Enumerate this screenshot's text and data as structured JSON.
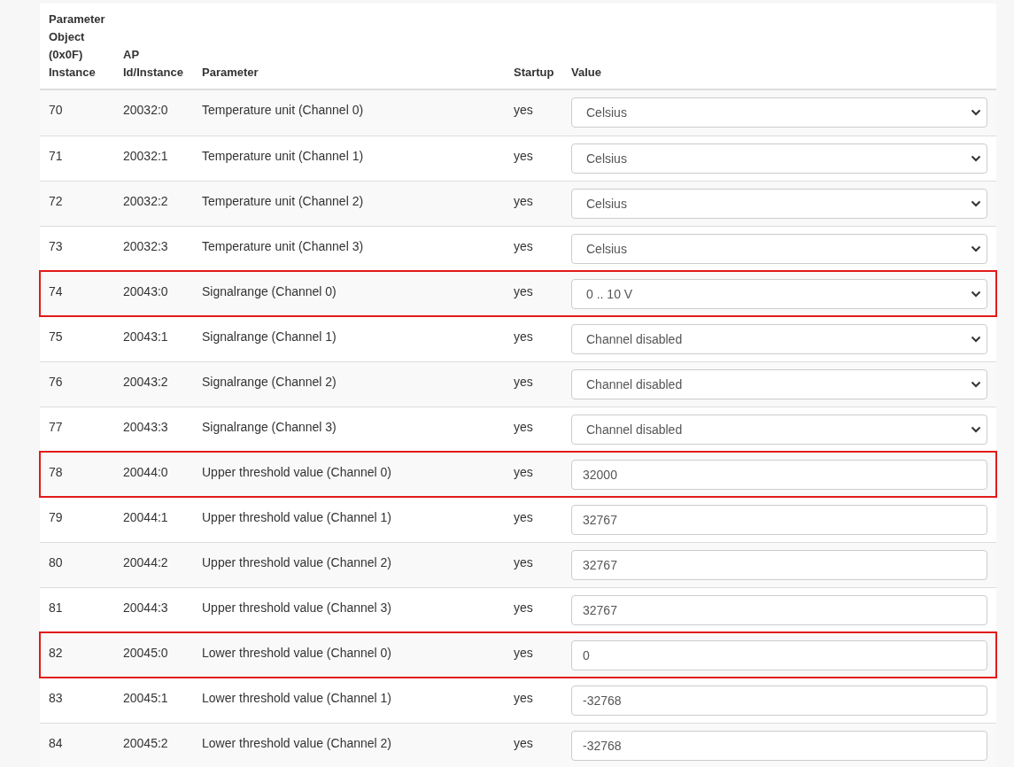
{
  "table": {
    "columns": [
      "Parameter Object (0x0F) Instance",
      "AP Id/Instance",
      "Parameter",
      "Startup",
      "Value"
    ],
    "rows": [
      {
        "instance": "70",
        "ap": "20032:0",
        "parameter": "Temperature unit (Channel 0)",
        "startup": "yes",
        "kind": "select",
        "value": "Celsius",
        "highlighted": false
      },
      {
        "instance": "71",
        "ap": "20032:1",
        "parameter": "Temperature unit (Channel 1)",
        "startup": "yes",
        "kind": "select",
        "value": "Celsius",
        "highlighted": false
      },
      {
        "instance": "72",
        "ap": "20032:2",
        "parameter": "Temperature unit (Channel 2)",
        "startup": "yes",
        "kind": "select",
        "value": "Celsius",
        "highlighted": false
      },
      {
        "instance": "73",
        "ap": "20032:3",
        "parameter": "Temperature unit (Channel 3)",
        "startup": "yes",
        "kind": "select",
        "value": "Celsius",
        "highlighted": false
      },
      {
        "instance": "74",
        "ap": "20043:0",
        "parameter": "Signalrange (Channel 0)",
        "startup": "yes",
        "kind": "select",
        "value": "0 .. 10 V",
        "highlighted": true
      },
      {
        "instance": "75",
        "ap": "20043:1",
        "parameter": "Signalrange (Channel 1)",
        "startup": "yes",
        "kind": "select",
        "value": "Channel disabled",
        "highlighted": false
      },
      {
        "instance": "76",
        "ap": "20043:2",
        "parameter": "Signalrange (Channel 2)",
        "startup": "yes",
        "kind": "select",
        "value": "Channel disabled",
        "highlighted": false
      },
      {
        "instance": "77",
        "ap": "20043:3",
        "parameter": "Signalrange (Channel 3)",
        "startup": "yes",
        "kind": "select",
        "value": "Channel disabled",
        "highlighted": false
      },
      {
        "instance": "78",
        "ap": "20044:0",
        "parameter": "Upper threshold value (Channel 0)",
        "startup": "yes",
        "kind": "input",
        "value": "32000",
        "highlighted": true
      },
      {
        "instance": "79",
        "ap": "20044:1",
        "parameter": "Upper threshold value (Channel 1)",
        "startup": "yes",
        "kind": "input",
        "value": "32767",
        "highlighted": false
      },
      {
        "instance": "80",
        "ap": "20044:2",
        "parameter": "Upper threshold value (Channel 2)",
        "startup": "yes",
        "kind": "input",
        "value": "32767",
        "highlighted": false
      },
      {
        "instance": "81",
        "ap": "20044:3",
        "parameter": "Upper threshold value (Channel 3)",
        "startup": "yes",
        "kind": "input",
        "value": "32767",
        "highlighted": false
      },
      {
        "instance": "82",
        "ap": "20045:0",
        "parameter": "Lower threshold value (Channel 0)",
        "startup": "yes",
        "kind": "input",
        "value": "0",
        "highlighted": true
      },
      {
        "instance": "83",
        "ap": "20045:1",
        "parameter": "Lower threshold value (Channel 1)",
        "startup": "yes",
        "kind": "input",
        "value": "-32768",
        "highlighted": false
      },
      {
        "instance": "84",
        "ap": "20045:2",
        "parameter": "Lower threshold value (Channel 2)",
        "startup": "yes",
        "kind": "input",
        "value": "-32768",
        "highlighted": false
      }
    ]
  }
}
